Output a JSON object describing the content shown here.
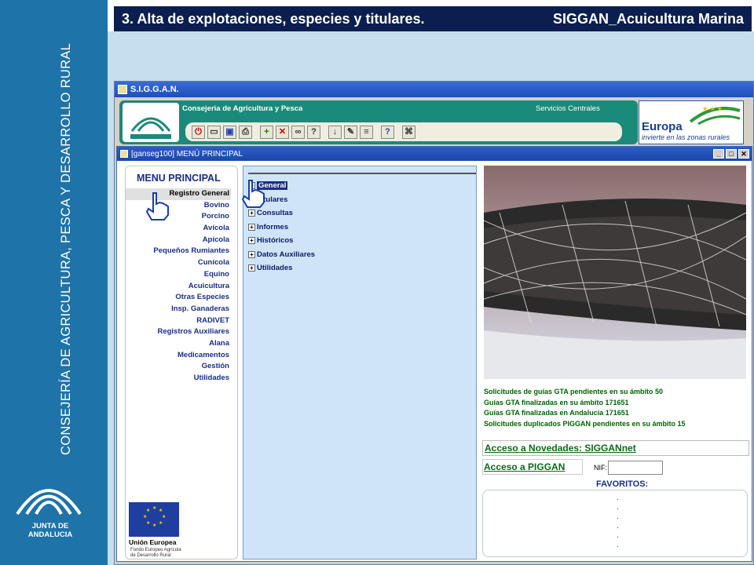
{
  "slide": {
    "title": "3. Alta de explotaciones, especies y titulares.",
    "subtitle": "SIGGAN_Acuicultura Marina"
  },
  "brand": {
    "vertical_text": "CONSEJERÍA DE AGRICULTURA, PESCA Y DESARROLLO RURAL",
    "logo_text": "JUNTA DE ANDALUCIA"
  },
  "app": {
    "title": "S.I.G.G.A.N.",
    "header": {
      "consejeria": "Consejeria de Agricultura y Pesca",
      "servicios": "Servicios Centrales",
      "europa_title": "Europa",
      "europa_sub": "invierte en las zonas rurales"
    },
    "toolbar_icons": [
      "exit-icon",
      "open-folder-icon",
      "save-icon",
      "print-icon",
      "add-icon",
      "delete-icon",
      "search-binoculars-icon",
      "query-icon",
      "download-icon",
      "edit-icon",
      "list-icon",
      "help-icon",
      "tree-icon"
    ]
  },
  "menu_window": {
    "title": "[ganseg100] MENÚ PRINCIPAL",
    "controls": [
      "_",
      "□",
      "✕"
    ]
  },
  "menu_principal": {
    "heading": "MENU PRINCIPAL",
    "items": [
      "Registro General",
      "Bovino",
      "Porcino",
      "Avícola",
      "Apícola",
      "Pequeños Rumiantes",
      "Cunícola",
      "Equino",
      "Acuicultura",
      "Otras Especies",
      "Insp. Ganaderas",
      "RADIVET",
      "Registros Auxiliares",
      "Alana",
      "Medicamentos",
      "Gestión",
      "Utilidades"
    ],
    "selected": "Registro General",
    "ue_label": "Unión Europea",
    "ue_sub": "Fondo Europeo Agrícola de Desarrollo Rural"
  },
  "tree": {
    "items": [
      "General",
      "Titulares",
      "Consultas",
      "Informes",
      "Históricos",
      "Datos Auxiliares",
      "Utilidades"
    ],
    "active": "General"
  },
  "stats": [
    "Solicitudes de guías GTA pendientes en su ámbito 50",
    "Guías GTA finalizadas en su ámbito 171651",
    "Guías GTA finalizadas en Andalucía 171651",
    "Solicitudes duplicados PIGGAN pendientes en su ámbito 15"
  ],
  "links": {
    "novedades": "Acceso a Novedades: SIGGANnet",
    "piggan": "Acceso a PIGGAN",
    "nif_label": "NIF:",
    "nif_value": ""
  },
  "favoritos": {
    "label": "FAVORITOS:",
    "items": [
      ".",
      ".",
      ".",
      ".",
      ".",
      "."
    ]
  },
  "colors": {
    "title_bar": "#0a1f4f",
    "brand_blue": "#1e73a8",
    "header_teal": "#1a8a7a",
    "link_green": "#0a6a1a",
    "menu_blue": "#1a2e88"
  }
}
